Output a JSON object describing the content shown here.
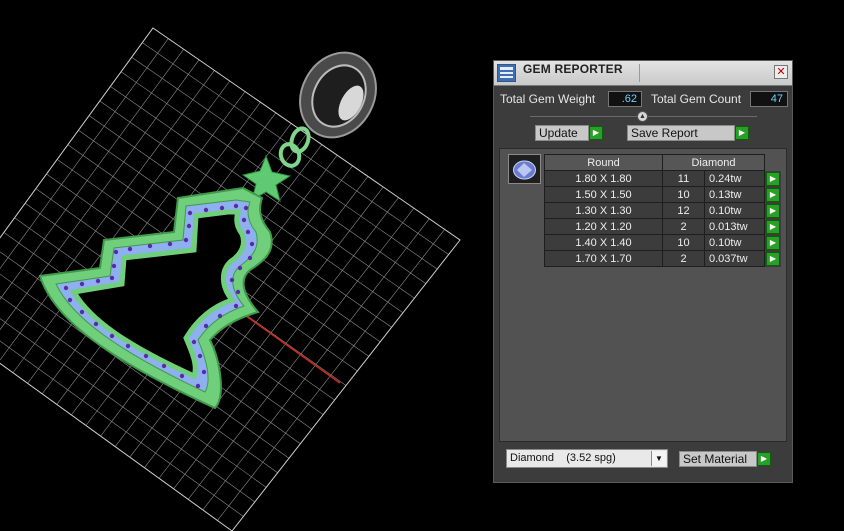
{
  "panel": {
    "title": "GEM REPORTER",
    "close_glyph": "✕",
    "icon": "gem-reporter-app-icon"
  },
  "totals": {
    "weight_label": "Total Gem Weight",
    "weight_value": ".62",
    "count_label": "Total Gem Count",
    "count_value": "47"
  },
  "buttons": {
    "update": "Update",
    "save_report": "Save Report",
    "set_material": "Set Material",
    "go_glyph": "▶"
  },
  "table": {
    "shape_header": "Round",
    "material_header": "Diamond",
    "rows": [
      {
        "size": "1.80 X 1.80",
        "count": "11",
        "weight": "0.24tw"
      },
      {
        "size": "1.50 X 1.50",
        "count": "10",
        "weight": "0.13tw"
      },
      {
        "size": "1.30 X 1.30",
        "count": "12",
        "weight": "0.10tw"
      },
      {
        "size": "1.20 X 1.20",
        "count": "2",
        "weight": "0.013tw"
      },
      {
        "size": "1.40 X 1.40",
        "count": "10",
        "weight": "0.10tw"
      },
      {
        "size": "1.70 X 1.70",
        "count": "2",
        "weight": "0.037tw"
      }
    ]
  },
  "material": {
    "selected": "Diamond    (3.52 spg)",
    "arrow_glyph": "▼"
  },
  "colors": {
    "panel_bg": "#3c3c3c",
    "value_text": "#6cd3ff",
    "go_button": "#28a028",
    "metal_green": "#6fcf7a",
    "gem_blue": "#8fb0ee"
  }
}
